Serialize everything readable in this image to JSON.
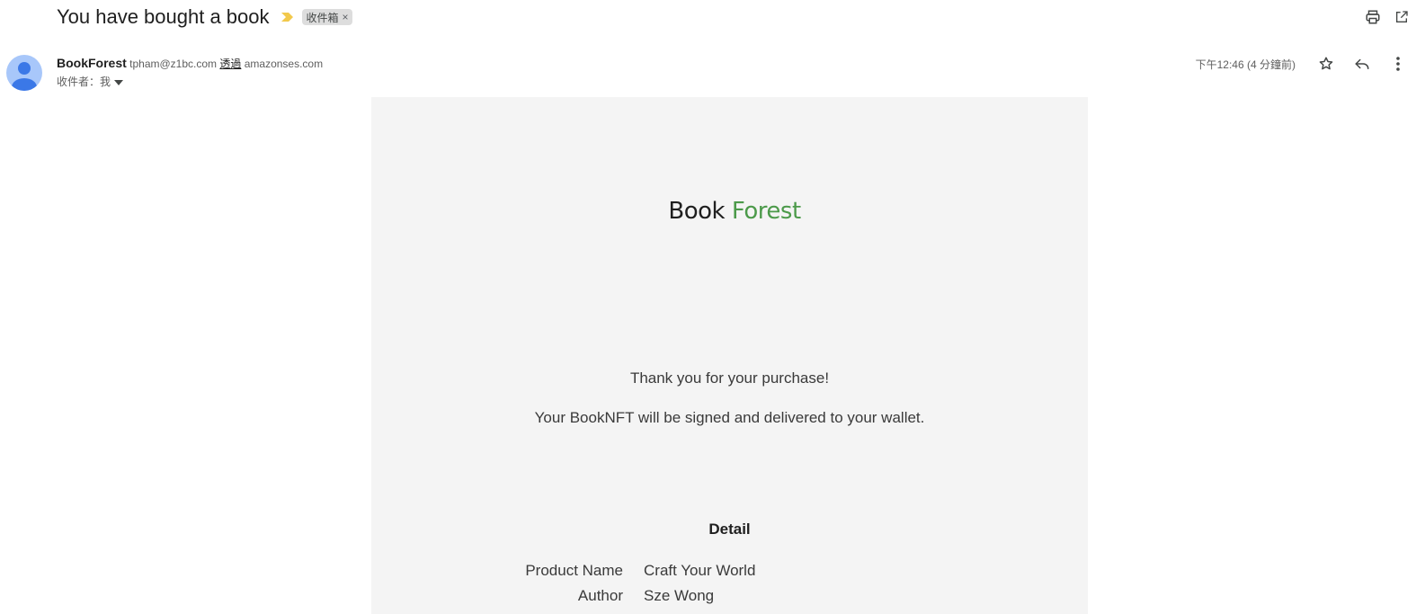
{
  "email": {
    "subject": "You have bought a book",
    "label": "收件箱",
    "label_remove": "×",
    "sender_name": "BookForest",
    "sender_email": "tpham@z1bc.com",
    "via_label": "透過",
    "via_domain": "amazonses.com",
    "recipient": "收件者：我",
    "timestamp": "下午12:46 (4 分鐘前)"
  },
  "body": {
    "brand_part1": "Book",
    "brand_part2": "Forest",
    "thanks": "Thank you for your purchase!",
    "wallet_message": "Your BookNFT will be signed and delivered to your wallet.",
    "detail_heading": "Detail",
    "details": [
      {
        "label": "Product Name",
        "value": "Craft Your World"
      },
      {
        "label": "Author",
        "value": "Sze Wong"
      }
    ]
  },
  "icons": {
    "importance": "importance-marker-icon",
    "print": "print-icon",
    "open_new_window": "open-in-new-window-icon",
    "star": "star-icon",
    "reply": "reply-icon",
    "more": "more-vert-icon",
    "avatar": "default-avatar-icon",
    "recipient_dropdown": "caret-down-icon"
  },
  "colors": {
    "brand_green": "#4c9a4a",
    "importance_yellow": "#f2c94c",
    "avatar_bg": "#a8c7fa",
    "avatar_fg": "#3b78e7",
    "body_bg": "#f4f4f4"
  }
}
